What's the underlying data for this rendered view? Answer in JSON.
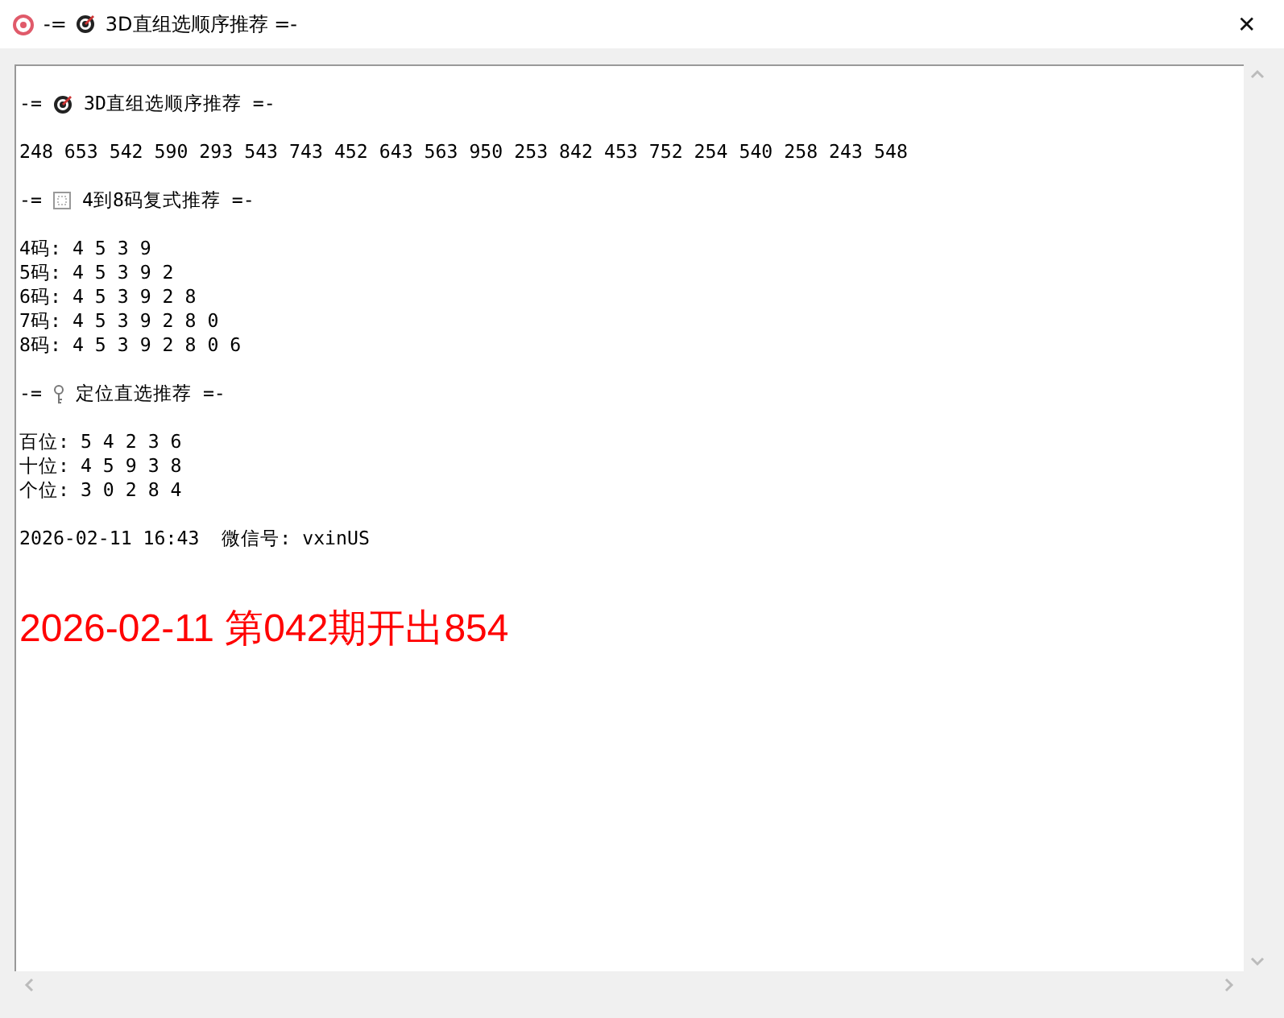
{
  "window": {
    "title_parts": [
      "-=",
      "3D直组选顺序推荐 =-"
    ],
    "close": "✕"
  },
  "blocks": [
    {
      "kind": "heading",
      "lead": "-=",
      "text": "3D直组选顺序推荐 =-"
    },
    {
      "kind": "lines",
      "lines": [
        "248 653 542 590 293 543 743 452 643 563 950 253 842 453 752 254 540 258 243 548"
      ]
    },
    {
      "kind": "heading",
      "lead": "-=",
      "text": "4到8码复式推荐 =-"
    },
    {
      "kind": "lines",
      "lines": [
        "4码: 4 5 3 9",
        "5码: 4 5 3 9 2",
        "6码: 4 5 3 9 2 8",
        "7码: 4 5 3 9 2 8 0",
        "8码: 4 5 3 9 2 8 0 6"
      ]
    },
    {
      "kind": "heading",
      "lead": "-=",
      "text": "定位直选推荐 =-"
    },
    {
      "kind": "lines",
      "lines": [
        "百位: 5 4 2 3 6",
        "十位: 4 5 9 3 8",
        "个位: 3 0 2 8 4"
      ]
    },
    {
      "kind": "lines",
      "lines": [
        "2026-02-11 16:43  微信号: vxinUS"
      ]
    }
  ],
  "result": "2026-02-11 第042期开出854"
}
